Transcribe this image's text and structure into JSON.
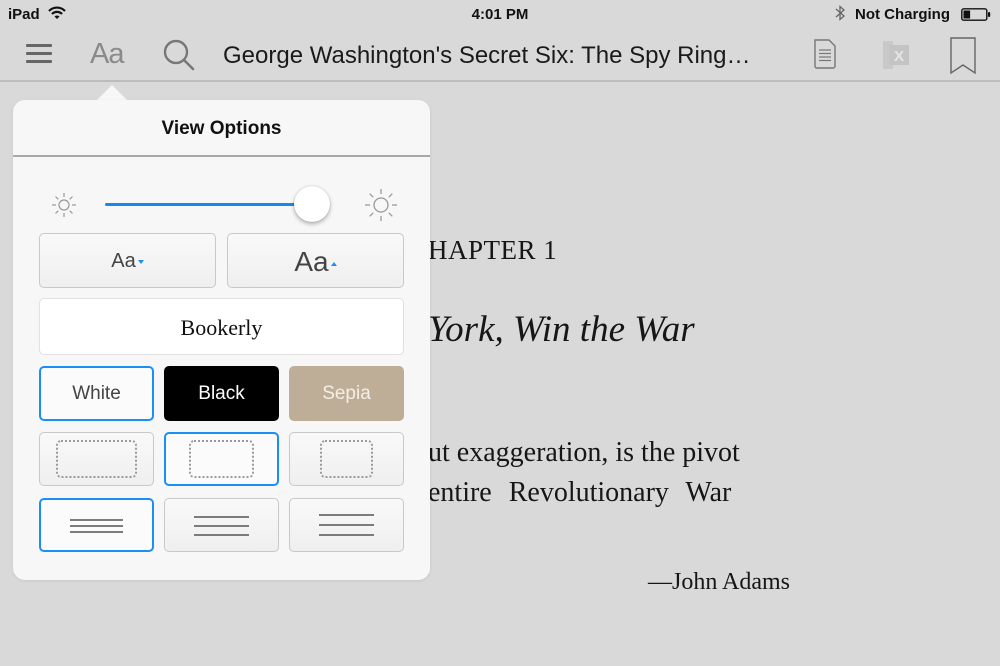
{
  "status_bar": {
    "device": "iPad",
    "wifi_icon": "wifi-icon",
    "time": "4:01 PM",
    "bluetooth_icon": "bluetooth-icon",
    "charging_status": "Not Charging",
    "battery_icon": "battery-icon",
    "battery_level_fraction": 0.3
  },
  "toolbar": {
    "menu_icon": "menu-icon",
    "view_options_label": "Aa",
    "search_icon": "search-icon",
    "book_title": "George Washington's Secret Six: The Spy Ring…",
    "notes_icon": "notes-icon",
    "xray_icon": "xray-icon",
    "xray_label": "X",
    "bookmark_icon": "bookmark-icon"
  },
  "page": {
    "chapter_heading": "HAPTER 1",
    "chapter_subtitle": "York, Win the War",
    "epigraph_line1": "ut exaggeration, is the pivot",
    "epigraph_line2": "entire Revolutionary War",
    "attribution": "—John Adams"
  },
  "view_options": {
    "title": "View Options",
    "brightness": {
      "min_icon": "sun-small-icon",
      "max_icon": "sun-large-icon",
      "value_fraction": 0.92
    },
    "font_size": {
      "decrease_label": "Aa",
      "increase_label": "Aa"
    },
    "font_family": "Bookerly",
    "themes": [
      {
        "label": "White",
        "color": "#ffffff",
        "selected": true
      },
      {
        "label": "Black",
        "color": "#000000",
        "selected": false
      },
      {
        "label": "Sepia",
        "color": "#bfae97",
        "selected": false
      }
    ],
    "margins": [
      {
        "name": "narrow",
        "selected": false
      },
      {
        "name": "normal",
        "selected": true
      },
      {
        "name": "wide",
        "selected": false
      }
    ],
    "line_spacing": [
      {
        "name": "compact",
        "selected": true
      },
      {
        "name": "normal",
        "selected": false
      },
      {
        "name": "wide",
        "selected": false
      }
    ],
    "accent_color": "#1a8ff5"
  }
}
